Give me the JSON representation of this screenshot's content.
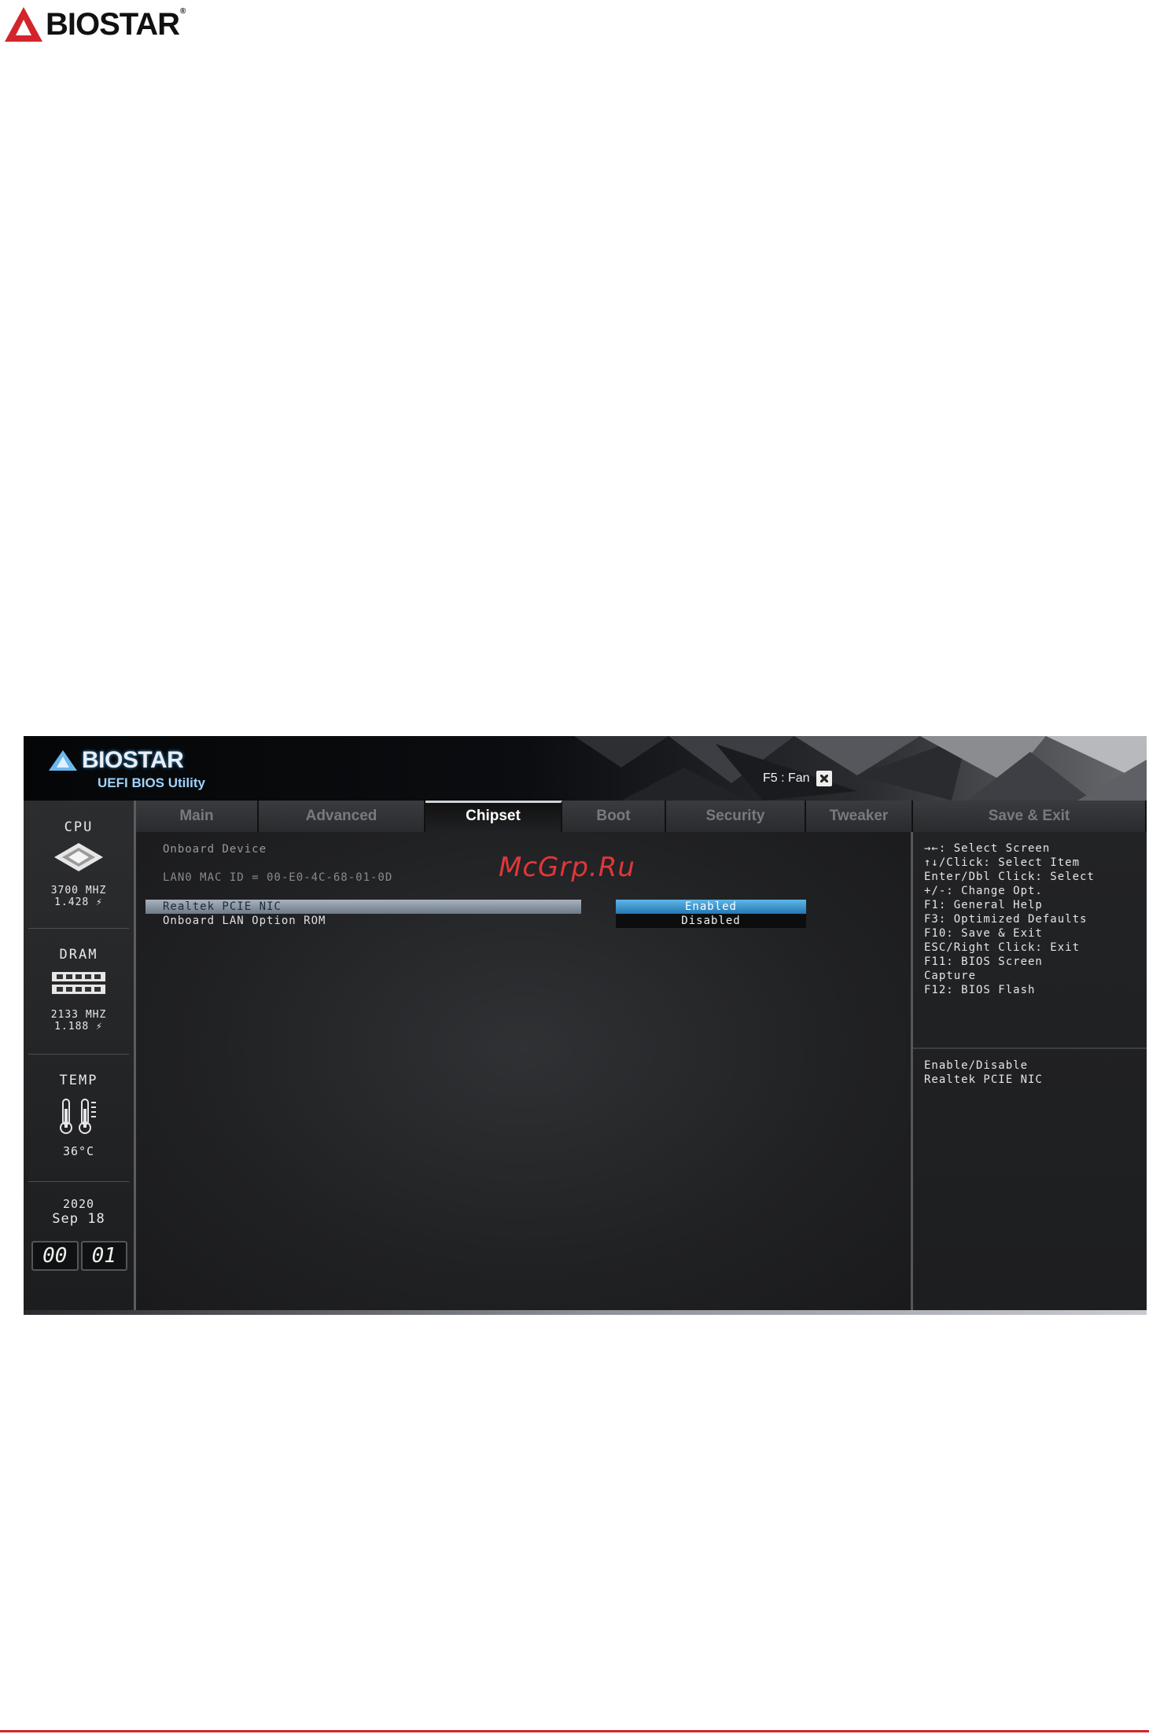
{
  "page_logo": {
    "brand": "BIOSTAR",
    "reg": "®"
  },
  "bios": {
    "brand": "BIOSTAR",
    "subtitle": "UEFI BIOS Utility",
    "fan_label": "F5 : Fan",
    "left_panel": {
      "cpu": {
        "title": "CPU",
        "freq": "3700 MHZ",
        "volt": "1.428 ⚡"
      },
      "dram": {
        "title": "DRAM",
        "freq": "2133 MHZ",
        "volt": "1.188 ⚡"
      },
      "temp": {
        "title": "TEMP",
        "value": "36°C"
      },
      "date": {
        "year": "2020",
        "month_day": "Sep 18"
      },
      "time": {
        "hour": "00",
        "minute": "01"
      }
    },
    "tabs": [
      {
        "label": "Main"
      },
      {
        "label": "Advanced"
      },
      {
        "label": "Chipset",
        "active": true
      },
      {
        "label": "Boot"
      },
      {
        "label": "Security"
      },
      {
        "label": "Tweaker"
      },
      {
        "label": "Save & Exit"
      }
    ],
    "main": {
      "section_title": "Onboard Device",
      "mac_line": "LAN0 MAC ID = 00-E0-4C-68-01-0D",
      "items": [
        {
          "label": "Realtek PCIE NIC",
          "value": "Enabled"
        },
        {
          "label": "Onboard LAN Option ROM",
          "value": "Disabled"
        }
      ]
    },
    "help": {
      "keys": [
        "→←: Select Screen",
        "↑↓/Click: Select Item",
        "Enter/Dbl Click: Select",
        "+/-: Change Opt.",
        "F1: General Help",
        "F3: Optimized Defaults",
        "F10: Save & Exit",
        "ESC/Right Click: Exit",
        "F11: BIOS Screen",
        "Capture",
        "F12: BIOS Flash"
      ],
      "description": [
        "Enable/Disable",
        "Realtek PCIE NIC"
      ]
    }
  },
  "watermark": "McGrp.Ru",
  "colors": {
    "accent_red": "#d4242b",
    "selection_blue": "#2478b4",
    "highlight_gray": "#a9b3be"
  }
}
